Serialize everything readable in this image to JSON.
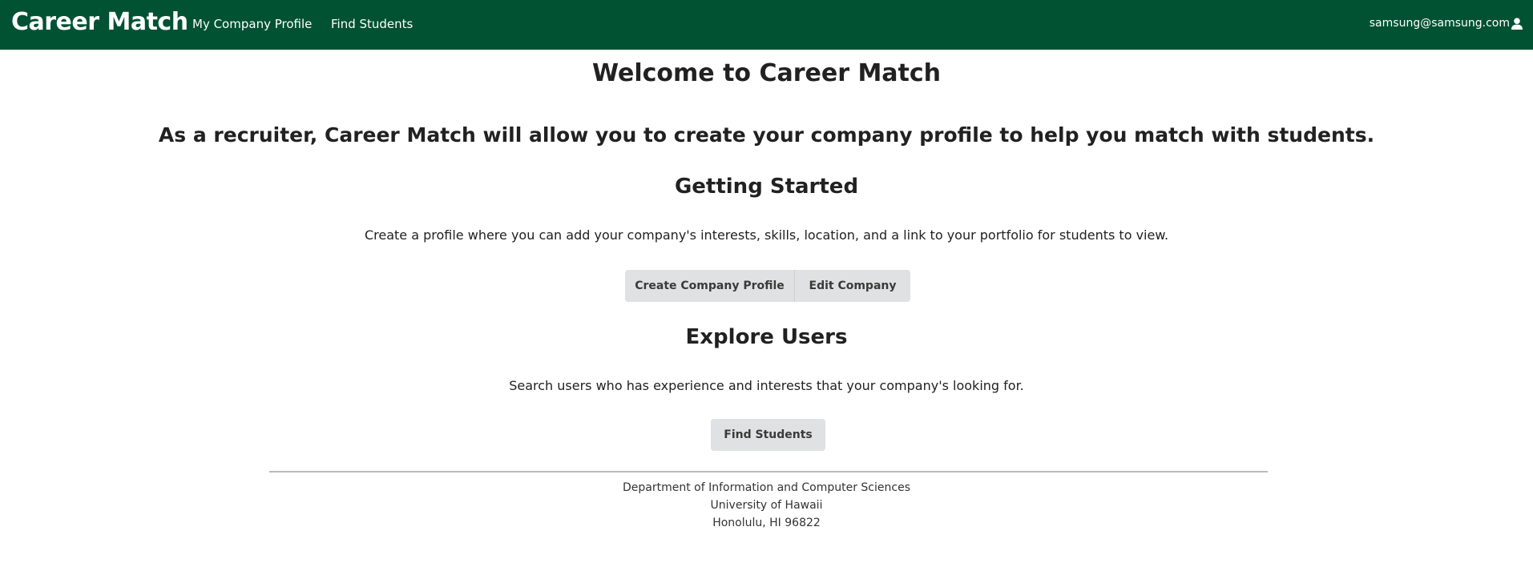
{
  "navbar": {
    "brand": "Career Match",
    "links": [
      "My Company Profile",
      "Find Students"
    ],
    "user_email": "samsung@samsung.com",
    "user_icon": "user-icon",
    "background_color": "#005232"
  },
  "main": {
    "title": "Welcome to Career Match",
    "subtitle": "As a recruiter, Career Match will allow you to create your company profile to help you match with students.",
    "getting_started": {
      "heading": "Getting Started",
      "text": "Create a profile where you can add your company's interests, skills, location, and a link to your portfolio for students to view.",
      "buttons": [
        "Create Company Profile",
        "Edit Company"
      ]
    },
    "explore": {
      "heading": "Explore Users",
      "text": "Search users who has experience and interests that your company's looking for.",
      "button": "Find Students"
    }
  },
  "footer": {
    "lines": [
      "Department of Information and Computer Sciences",
      "University of Hawaii",
      "Honolulu, HI 96822"
    ]
  }
}
